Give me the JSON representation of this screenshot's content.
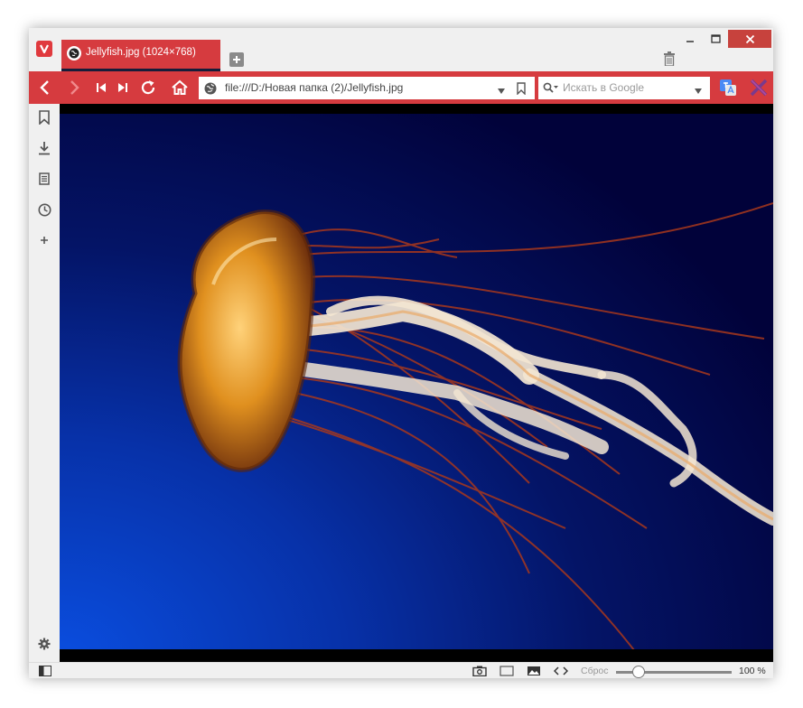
{
  "tab": {
    "title": "Jellyfish.jpg (1024×768)"
  },
  "address": {
    "url": "file:///D:/Новая папка (2)/Jellyfish.jpg"
  },
  "search": {
    "placeholder": "Искать в Google"
  },
  "statusbar": {
    "reset_label": "Сброс",
    "zoom": "100 %"
  },
  "colors": {
    "accent": "#d63b3f",
    "close": "#c7423d",
    "image_bg": "#020336"
  },
  "icons": {
    "sidebar": [
      "bookmark-icon",
      "download-icon",
      "notes-icon",
      "history-icon",
      "add-panel-icon",
      "settings-icon"
    ],
    "toolbar": [
      "back-icon",
      "forward-icon",
      "rewind-icon",
      "fast-forward-icon",
      "reload-icon",
      "home-icon"
    ]
  }
}
